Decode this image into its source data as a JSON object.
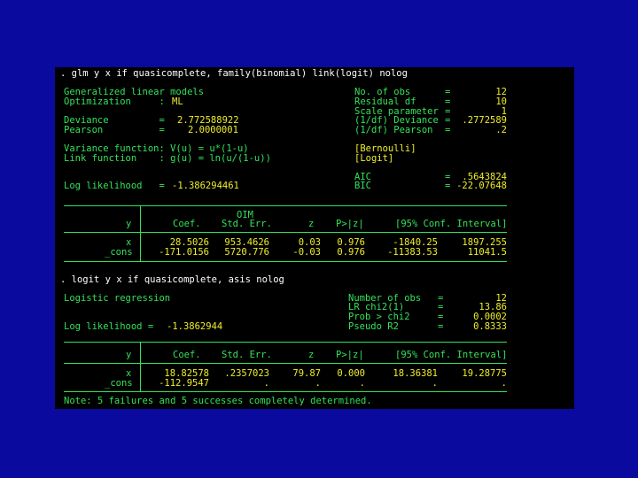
{
  "colors": {
    "background": "#0a0a9e",
    "console": "#000000",
    "command": "#ffffff",
    "label": "#33e35a",
    "value": "#f0ee2a"
  },
  "glm": {
    "command": ". glm y x if quasicomplete, family(binomial) link(logit) nolog",
    "left": [
      {
        "label": "Generalized linear models",
        "value": ""
      },
      {
        "label": "Optimization     :",
        "value": "ML"
      },
      {
        "label": "Deviance         =",
        "value": "2.772588922"
      },
      {
        "label": "Pearson          =",
        "value": "2.0000001"
      },
      {
        "label": "Variance function: V(u) = u*(1-u)",
        "value": ""
      },
      {
        "label": "Link function    : g(u) = ln(u/(1-u))",
        "value": ""
      },
      {
        "label": "Log likelihood   =",
        "value": "-1.386294461"
      }
    ],
    "right": [
      {
        "label": "No. of obs",
        "eq": "=",
        "value": "12"
      },
      {
        "label": "Residual df",
        "eq": "=",
        "value": "10"
      },
      {
        "label": "Scale parameter",
        "eq": "=",
        "value": "1"
      },
      {
        "label": "(1/df) Deviance",
        "eq": "=",
        "value": ".2772589"
      },
      {
        "label": "(1/df) Pearson",
        "eq": "=",
        "value": ".2"
      },
      {
        "label": "[Bernoulli]",
        "eq": "",
        "value": ""
      },
      {
        "label": "[Logit]",
        "eq": "",
        "value": ""
      },
      {
        "label": "AIC",
        "eq": "=",
        "value": ".5643824"
      },
      {
        "label": "BIC",
        "eq": "=",
        "value": "-22.07648"
      }
    ],
    "table": {
      "depvar": "y",
      "oim": "OIM",
      "headers": [
        "Coef.",
        "Std. Err.",
        "z",
        "P>|z|",
        "[95% Conf. Interval]"
      ],
      "rows": [
        {
          "name": "x",
          "values": [
            "28.5026",
            "953.4626",
            "0.03",
            "0.976",
            "-1840.25",
            "1897.255"
          ]
        },
        {
          "name": "_cons",
          "values": [
            "-171.0156",
            "5720.776",
            "-0.03",
            "0.976",
            "-11383.53",
            "11041.5"
          ]
        }
      ]
    }
  },
  "logit": {
    "command": ". logit y x if quasicomplete, asis nolog",
    "title": "Logistic regression",
    "loglik_label": "Log likelihood =",
    "loglik_value": "-1.3862944",
    "right": [
      {
        "label": "Number of obs",
        "eq": "=",
        "value": "12"
      },
      {
        "label": "LR chi2(1)",
        "eq": "=",
        "value": "13.86"
      },
      {
        "label": "Prob > chi2",
        "eq": "=",
        "value": "0.0002"
      },
      {
        "label": "Pseudo R2",
        "eq": "=",
        "value": "0.8333"
      }
    ],
    "table": {
      "depvar": "y",
      "headers": [
        "Coef.",
        "Std. Err.",
        "z",
        "P>|z|",
        "[95% Conf. Interval]"
      ],
      "rows": [
        {
          "name": "x",
          "values": [
            "18.82578",
            ".2357023",
            "79.87",
            "0.000",
            "18.36381",
            "19.28775"
          ]
        },
        {
          "name": "_cons",
          "values": [
            "-112.9547",
            ".",
            ".",
            ".",
            ".",
            "."
          ]
        }
      ]
    },
    "note": "Note: 5 failures and 5 successes completely determined."
  }
}
